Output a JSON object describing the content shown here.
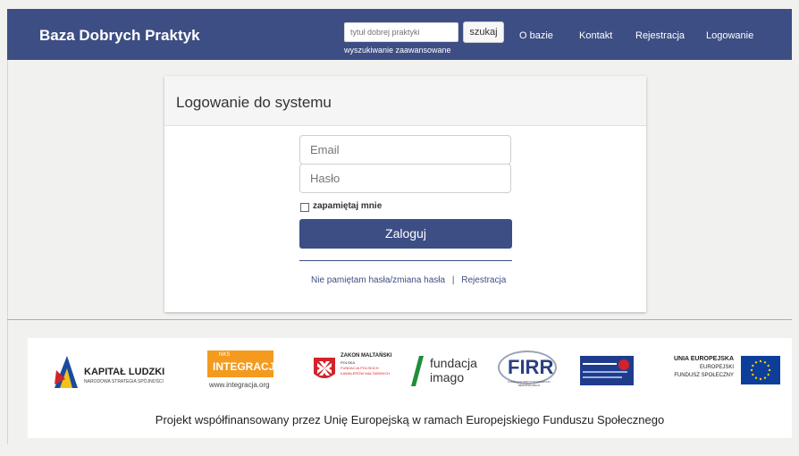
{
  "header": {
    "brand": "Baza Dobrych Praktyk",
    "search_placeholder": "tytuł dobrej praktyki",
    "search_button": "szukaj",
    "advanced_search": "wyszukiwanie zaawansowane",
    "links": [
      "O bazie",
      "Kontakt",
      "Rejestracja",
      "Logowanie"
    ]
  },
  "login": {
    "title": "Logowanie do systemu",
    "email_placeholder": "Email",
    "password_placeholder": "Hasło",
    "remember_label": "zapamiętaj mnie",
    "submit": "Zaloguj",
    "forgot_link": "Nie pamiętam hasła/zmiana hasła",
    "separator": "|",
    "register_link": "Rejestracja"
  },
  "footer": {
    "logos": {
      "kapital_title": "KAPITAŁ LUDZKI",
      "kapital_sub": "NARODOWA STRATEGIA SPÓJNOŚCI",
      "integracja_small": "NKS",
      "integracja_title": "INTEGRACJA",
      "integracja_url": "www.integracja.org",
      "zakon_line1": "ZAKON MALTAŃSKI",
      "zakon_line2": "POLSKA",
      "zakon_line3": "FUNDACJA POLSKICH",
      "zakon_line4": "KAWALERÓW MALTAŃSKICH",
      "imago_1": "fundacja",
      "imago_2": "imago",
      "firr": "FIRR",
      "firr_sub": "FUNDACJA INSTYTUT ROZWOJU REGIONALNEGO",
      "ue_1": "UNIA EUROPEJSKA",
      "ue_2": "EUROPEJSKI",
      "ue_3": "FUNDUSZ SPOŁECZNY"
    },
    "text": "Projekt współfinansowany przez Unię Europejską w ramach Europejskiego Funduszu Społecznego"
  },
  "colors": {
    "navy": "#3d4e84",
    "orange": "#f39a1f",
    "ue_blue": "#0d3f9a",
    "red": "#d3232a"
  },
  "icons": [
    "kapital-ludzki-logo",
    "maltese-cross-icon",
    "eu-flag-icon"
  ]
}
